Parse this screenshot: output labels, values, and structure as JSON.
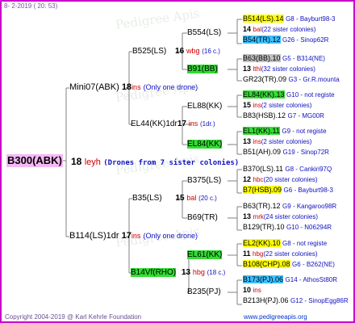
{
  "date": "8-  2-2019  ( 20: 53)",
  "watermark": "Pedigree Apis",
  "root": {
    "name": "B300(ABK)",
    "num": "18",
    "breeder": "leyh",
    "note": "(Drones from 7 sister colonies)"
  },
  "gen1": [
    {
      "name": "Mini07(ABK)",
      "num": "18",
      "breeder": "ins",
      "note": "(Only one drone)"
    },
    {
      "name": "B114(LS)1dr",
      "num": "17",
      "breeder": "ins",
      "note": "(Only one drone)"
    }
  ],
  "gen2": [
    {
      "name": "B525(LS)",
      "num": "16",
      "breeder": "wbg",
      "note": "(16 c.)"
    },
    {
      "name": "EL44(KK)1dr",
      "num": "17",
      "breeder": "ins",
      "note": "(1dr.)"
    },
    {
      "name": "B35(LS)",
      "num": "15",
      "breeder": "bal",
      "note": "(20 c.)"
    },
    {
      "name": "B14Vf(RHO)",
      "num": "13",
      "breeder": "hbg",
      "note": "(18 c.)"
    }
  ],
  "gen3": [
    {
      "name": "B554(LS)"
    },
    {
      "name": "B91(BB)"
    },
    {
      "name": "EL88(KK)"
    },
    {
      "name": "EL84(KK)"
    },
    {
      "name": "B375(LS)"
    },
    {
      "name": "B69(TR)"
    },
    {
      "name": "EL61(KK)"
    },
    {
      "name": "B235(PJ)"
    }
  ],
  "gen4": [
    {
      "sire": "B514(LS).14",
      "sire_info": "G8 - Bayburt98-3",
      "num": "14",
      "breeder": "bal",
      "note": "(22 sister colonies)",
      "dam": "B54(TR).12",
      "dam_info": "G26 - Sinop62R"
    },
    {
      "sire": "B63(BB).10",
      "sire_info": "G5 - B314(NE)",
      "num": "13",
      "breeder": "lthl",
      "note": "(32 sister colonies)",
      "dam": "GR23(TR).09",
      "dam_info": "G3 - Gr.R.mounta"
    },
    {
      "sire": "EL84(KK).13",
      "sire_info": "G10 - not registe",
      "num": "15",
      "breeder": "ins",
      "note": "(2 sister colonies)",
      "dam": "B83(HSB).12",
      "dam_info": "G7 - MG00R"
    },
    {
      "sire": "EL1(KK).11",
      "sire_info": "G9 - not registe",
      "num": "13",
      "breeder": "ins",
      "note": "(2 sister colonies)",
      "dam": "B51(AH).09",
      "dam_info": "G19 - Sinop72R"
    },
    {
      "sire": "B370(LS).11",
      "sire_info": "G8 - Cankiri97Q",
      "num": "12",
      "breeder": "hbc",
      "note": "(20 sister colonies)",
      "dam": "B7(HSB).09",
      "dam_info": "G6 - Bayburt98-3"
    },
    {
      "sire": "B63(TR).12",
      "sire_info": "G9 - Kangaroo98R",
      "num": "13",
      "breeder": "mrk",
      "note": "(24 sister colonies)",
      "dam": "B129(TR).10",
      "dam_info": "G10 - N06294R"
    },
    {
      "sire": "EL2(KK).10",
      "sire_info": "G8 - not registe",
      "num": "11",
      "breeder": "hbg",
      "note": "(22 sister colonies)",
      "dam": "B108(CHP).08",
      "dam_info": "G6 - B262(NE)"
    },
    {
      "sire": "B173(PJ).06",
      "sire_info": "G14 - AthosSt80R",
      "num": "10",
      "breeder": "ins",
      "note": "",
      "dam": "B213H(PJ).06",
      "dam_info": "G12 - SinopEgg86R"
    }
  ],
  "footer": "Copyright 2004-2019 @ Karl Kehrle Foundation",
  "url": "www.pedigreeapis.org"
}
